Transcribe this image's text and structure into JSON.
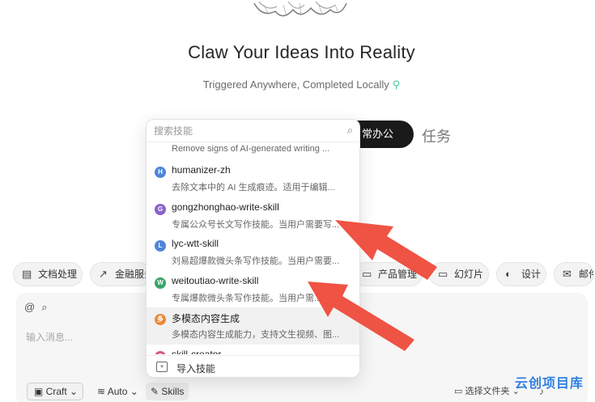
{
  "hero": {
    "title": "Claw Your Ideas Into Reality",
    "subtitle": "Triggered Anywhere, Completed Locally"
  },
  "modes": {
    "active_label": "常办公",
    "task_label": "任务"
  },
  "skill_popup": {
    "search_placeholder": "搜索技能",
    "partial_top_desc": "Remove signs of AI-generated writing ...",
    "items": [
      {
        "avatar": "H",
        "avatar_color": "#4e86d8",
        "name": "humanizer-zh",
        "desc": "去除文本中的 AI 生成痕迹。适用于编辑..."
      },
      {
        "avatar": "G",
        "avatar_color": "#8a63c9",
        "name": "gongzhonghao-write-skill",
        "desc": "专属公众号长文写作技能。当用户需要写..."
      },
      {
        "avatar": "L",
        "avatar_color": "#4e86d8",
        "name": "lyc-wtt-skill",
        "desc": "刘易超爆款微头条写作技能。当用户需要..."
      },
      {
        "avatar": "W",
        "avatar_color": "#3aa56b",
        "name": "weitoutiao-write-skill",
        "desc": "专属爆款微头条写作技能。当用户需..."
      },
      {
        "avatar": "多",
        "avatar_color": "#e88a3a",
        "name": "多模态内容生成",
        "desc": "多模态内容生成能力，支持文生视频、图..."
      },
      {
        "avatar": "S",
        "avatar_color": "#d9568a",
        "name": "skill-creator",
        "desc": ""
      }
    ],
    "selected_index": 4,
    "import_label": "导入技能"
  },
  "chips": [
    {
      "icon": "document-icon",
      "label": "文档处理"
    },
    {
      "icon": "chart-icon",
      "label": "金融服务"
    },
    {
      "icon": "folder-icon",
      "label": "产品管理"
    },
    {
      "icon": "slides-icon",
      "label": "幻灯片"
    },
    {
      "icon": "palette-icon",
      "label": "设计"
    },
    {
      "icon": "mail-icon",
      "label": "邮件"
    }
  ],
  "composer": {
    "placeholder": "输入消息..."
  },
  "toolbar": {
    "craft_label": "Craft",
    "auto_label": "Auto",
    "skills_label": "Skills",
    "folder_label": "选择文件夹"
  },
  "watermark": "云创项目库"
}
